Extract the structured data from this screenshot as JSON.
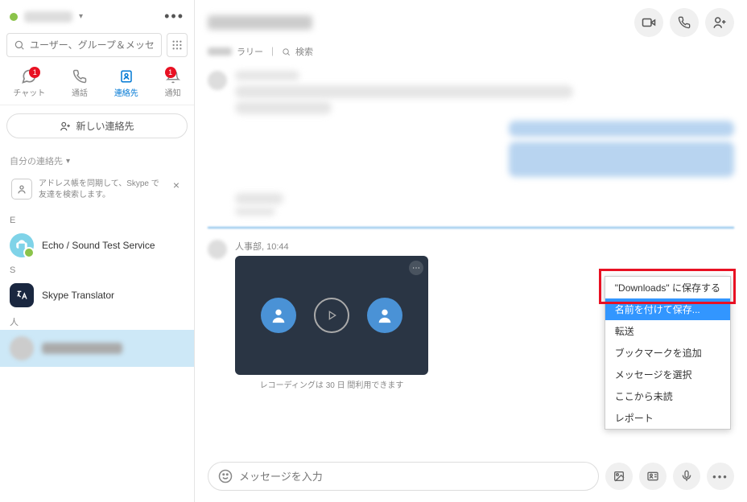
{
  "sidebar": {
    "search_placeholder": "ユーザー、グループ＆メッセージ",
    "tabs": {
      "chat": "チャット",
      "call": "通話",
      "contacts": "連絡先",
      "notify": "通知",
      "chat_badge": "1",
      "notify_badge": "1"
    },
    "new_contact": "新しい連絡先",
    "my_contacts_label": "自分の連絡先",
    "sync_text": "アドレス帳を同期して、Skype で友達を検索します。",
    "letter_e": "E",
    "echo_name": "Echo / Sound Test Service",
    "letter_s": "S",
    "translator_name": "Skype Translator",
    "letter_hito": "人"
  },
  "header": {
    "gallery": "ラリー",
    "divider": "｜",
    "search_label": "検索"
  },
  "recording": {
    "meta_sender": "人事部",
    "meta_time": "10:44",
    "caption": "レコーディングは 30 日 間利用できます"
  },
  "context_menu": {
    "items": [
      "\"Downloads\" に保存する",
      "名前を付けて保存...",
      "転送",
      "ブックマークを追加",
      "メッセージを選択",
      "ここから未読",
      "レポート"
    ],
    "highlighted_index": 1
  },
  "input": {
    "placeholder": "メッセージを入力"
  }
}
